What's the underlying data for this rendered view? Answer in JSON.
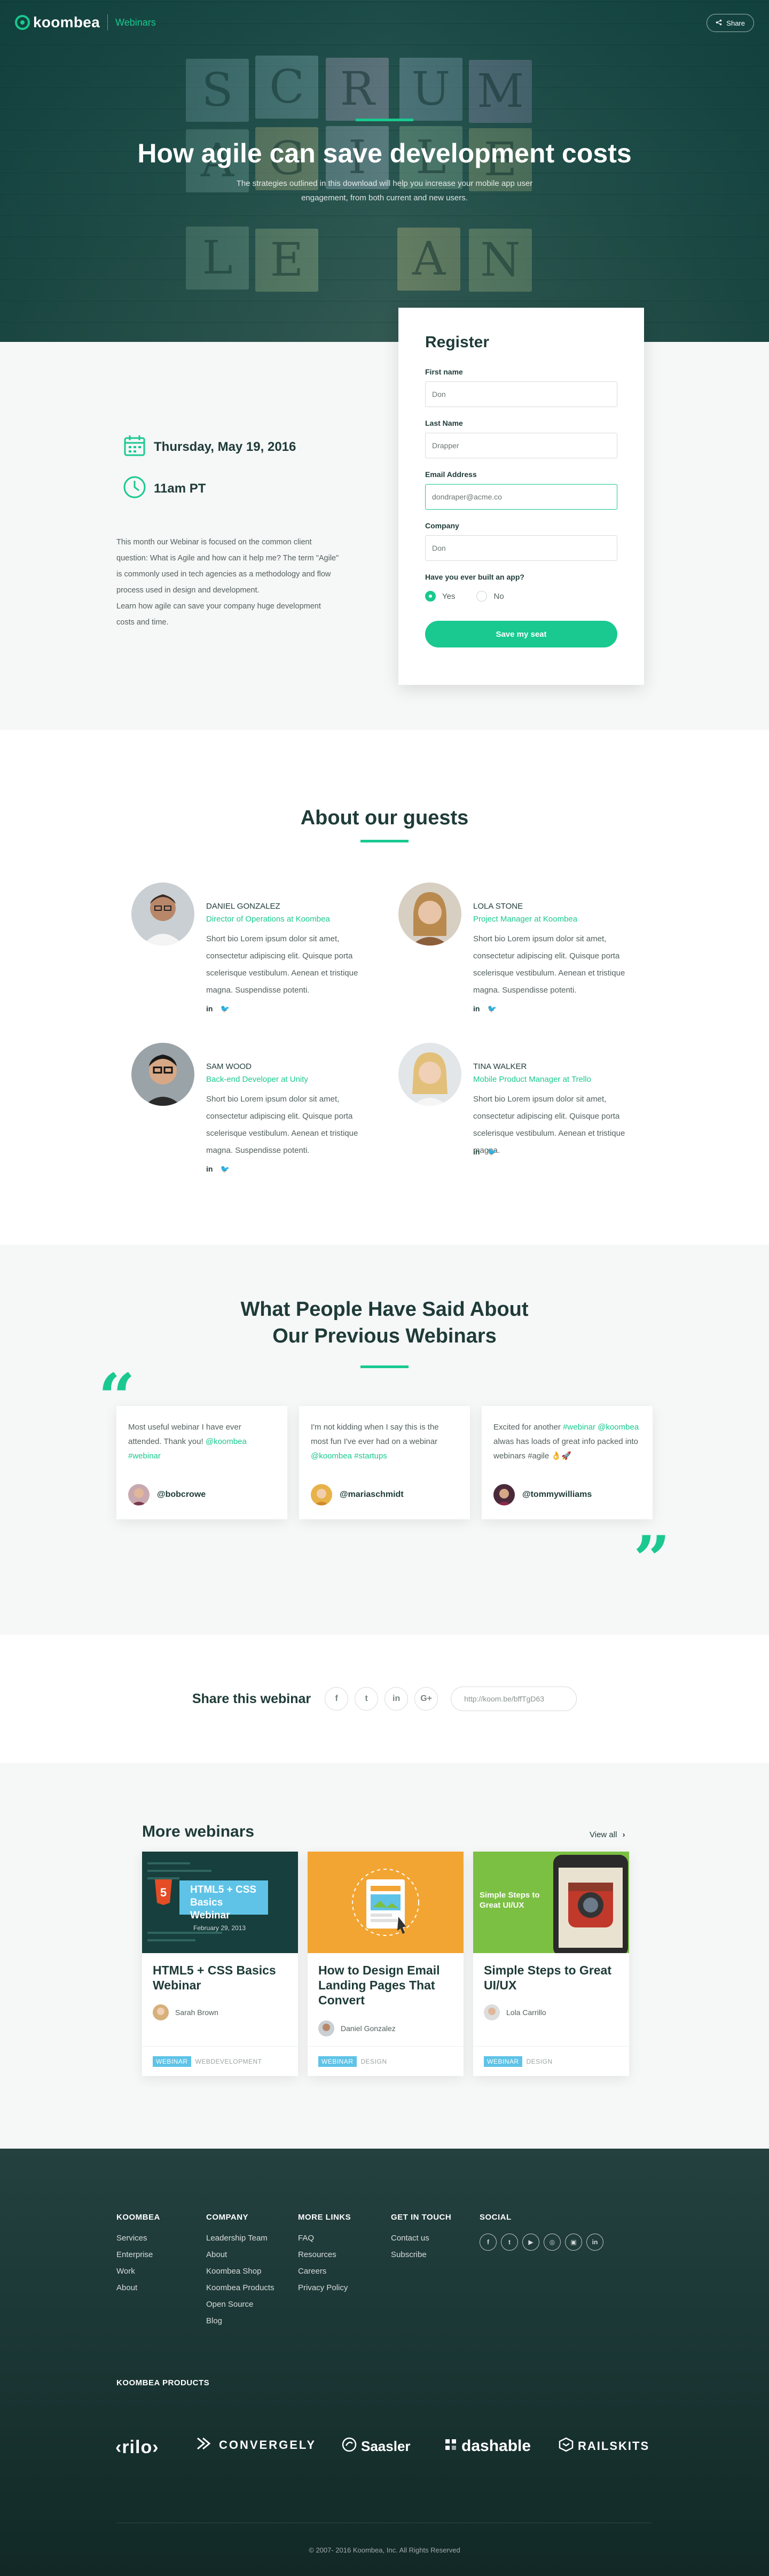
{
  "header": {
    "logo_text": "koombea",
    "section_tag": "Webinars",
    "share_label": "Share"
  },
  "hero": {
    "title": "How agile can save development costs",
    "subtitle": "The strategies outlined in this download will help you increase your mobile app user engagement, from both current and new users.",
    "board_letters": [
      "S",
      "C",
      "R",
      "U",
      "M",
      "A",
      "G",
      "I",
      "L",
      "E",
      "L",
      "E",
      "A",
      "N"
    ]
  },
  "event": {
    "date": "Thursday, May 19, 2016",
    "time": "11am PT",
    "description_1": "This month our Webinar is focused on the common client question: What is Agile and how can it help me? The term \"Agile\" is commonly used in tech agencies as a methodology and flow process used in design and development.",
    "description_2": "Learn how agile can save your company huge development costs and time."
  },
  "register": {
    "title": "Register",
    "first_name_label": "First name",
    "first_name_value": "Don",
    "last_name_label": "Last Name",
    "last_name_value": "Drapper",
    "email_label": "Email Address",
    "email_value": "dondraper@acme.co",
    "company_label": "Company",
    "company_value": "Don",
    "question": "Have you ever built an app?",
    "opt_yes": "Yes",
    "opt_no": "No",
    "selected": "Yes",
    "submit": "Save my seat"
  },
  "guests": {
    "title": "About our guests",
    "items": [
      {
        "name": "DANIEL GONZALEZ",
        "role": "Director of Operations at Koombea",
        "bio": "Short bio Lorem ipsum dolor sit amet, consectetur adipiscing elit. Quisque porta scelerisque vestibulum. Aenean et tristique magna. Suspendisse potenti."
      },
      {
        "name": "LOLA STONE",
        "role": "Project Manager at Koombea",
        "bio": "Short bio Lorem ipsum dolor sit amet, consectetur adipiscing elit. Quisque porta scelerisque vestibulum. Aenean et tristique magna. Suspendisse potenti."
      },
      {
        "name": "SAM WOOD",
        "role": "Back-end Developer at Unity",
        "bio": "Short bio Lorem ipsum dolor sit amet, consectetur adipiscing elit. Quisque porta scelerisque vestibulum. Aenean et tristique magna. Suspendisse potenti."
      },
      {
        "name": "TINA WALKER",
        "role": "Mobile Product Manager at Trello",
        "bio": "Short bio Lorem ipsum dolor sit amet, consectetur adipiscing elit. Quisque porta scelerisque vestibulum. Aenean et tristique magna."
      }
    ],
    "linkedin_glyph": "in",
    "twitter_glyph": "✔"
  },
  "testimonials": {
    "title_line1": "What People Have Said About",
    "title_line2": "Our Previous Webinars",
    "items": [
      {
        "text_a": "Most useful webinar I have ever attended. Thank you! ",
        "tags": "@koombea #webinar",
        "text_b": "",
        "user": "@bobcrowe"
      },
      {
        "text_a": "I'm not kidding when I say this is the most fun I've ever had on a webinar ",
        "tags": "@koombea #startups",
        "text_b": "",
        "user": "@mariaschmidt"
      },
      {
        "text_a": "Excited for another ",
        "tags": "#webinar @koombea",
        "text_b": " alwas has loads of great info packed into webinars #agile 👌🚀",
        "user": "@tommywilliams"
      }
    ]
  },
  "share": {
    "label": "Share this webinar",
    "icons": [
      "f",
      "t",
      "in",
      "G+"
    ],
    "url": "http://koom.be/bffTgD63"
  },
  "more_webinars": {
    "title": "More webinars",
    "view_all": "View all",
    "cards": [
      {
        "title": "HTML5 + CSS Basics Webinar",
        "thumb_title": "HTML5 + CSS Basics Webinar",
        "thumb_date": "February 29, 2013",
        "author": "Sarah Brown",
        "tag1": "WEBINAR",
        "tag2": "WEBDEVELOPMENT"
      },
      {
        "title": "How to Design Email Landing Pages That Convert",
        "author": "Daniel Gonzalez",
        "tag1": "WEBINAR",
        "tag2": "DESIGN"
      },
      {
        "title": "Simple Steps to Great UI/UX",
        "thumb_title": "Simple Steps to Great UI/UX",
        "author": "Lola Carrillo",
        "tag1": "WEBINAR",
        "tag2": "DESIGN"
      }
    ],
    "colors": {
      "card1_thumb": "#18524f",
      "card2_thumb": "#f3a533",
      "card3_thumb": "#7bc043"
    }
  },
  "footer": {
    "koombea": {
      "title": "KOOMBEA",
      "links": [
        "Services",
        "Enterprise",
        "Work",
        "About"
      ]
    },
    "company": {
      "title": "COMPANY",
      "links": [
        "Leadership Team",
        "About",
        "Koombea Shop",
        "Koombea Products",
        "Open Source",
        "Blog"
      ]
    },
    "more_links": {
      "title": "MORE LINKS",
      "links": [
        "FAQ",
        "Resources",
        "Careers",
        "Privacy Policy"
      ]
    },
    "get_in_touch": {
      "title": "GET IN TOUCH",
      "links": [
        "Contact us",
        "Subscribe"
      ]
    },
    "social": {
      "title": "SOCIAL",
      "icons": [
        "f",
        "t",
        "▶",
        "◎",
        "▣",
        "in"
      ]
    },
    "products_title": "KOOMBEA PRODUCTS",
    "products": [
      "‹rilo›",
      "CONVERGELY",
      "Saasler",
      "dashable",
      "RAILSKITS"
    ],
    "copyright": "© 2007- 2016 Koombea, Inc. All Rights Reserved"
  },
  "accent_color": "#19c98f"
}
